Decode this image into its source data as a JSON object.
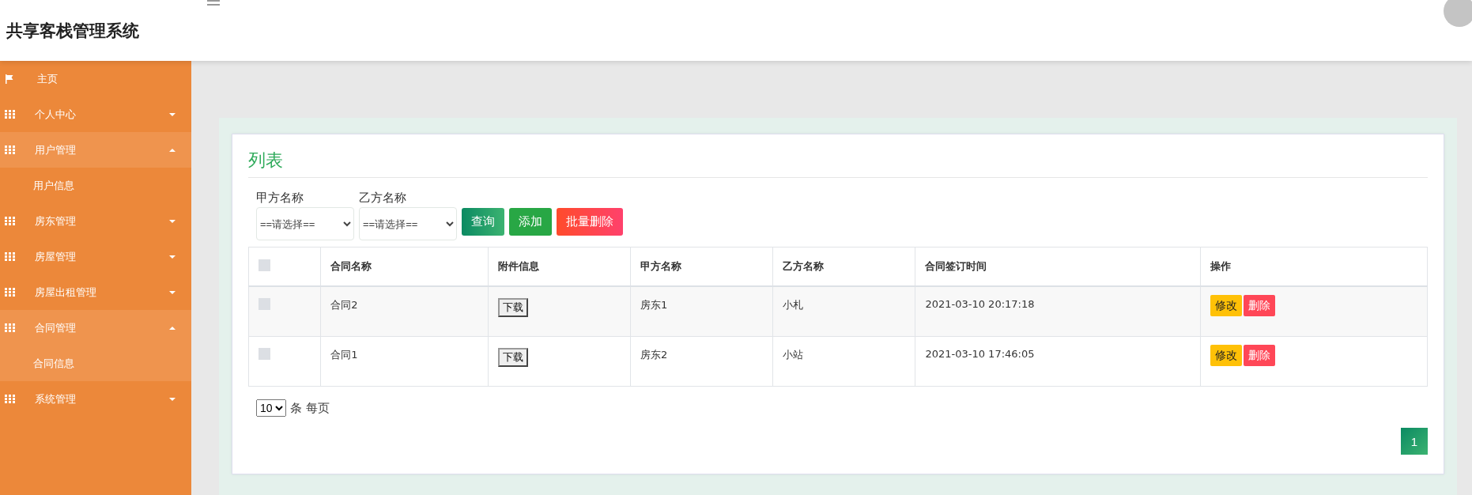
{
  "header": {
    "title": "共享客栈管理系统"
  },
  "sidebar": {
    "items": [
      {
        "label": "主页",
        "kind": "home"
      },
      {
        "label": "个人中心",
        "kind": "group",
        "expanded": false
      },
      {
        "label": "用户管理",
        "kind": "group",
        "expanded": true,
        "children": [
          {
            "label": "用户信息",
            "selected": false
          }
        ]
      },
      {
        "label": "房东管理",
        "kind": "group",
        "expanded": false
      },
      {
        "label": "房屋管理",
        "kind": "group",
        "expanded": false
      },
      {
        "label": "房屋出租管理",
        "kind": "group",
        "expanded": false
      },
      {
        "label": "合同管理",
        "kind": "group",
        "expanded": true,
        "children": [
          {
            "label": "合同信息",
            "selected": true
          }
        ]
      },
      {
        "label": "系统管理",
        "kind": "group",
        "expanded": false
      }
    ]
  },
  "panel": {
    "title": "列表",
    "filters": [
      {
        "label": "甲方名称",
        "value": "==请选择=="
      },
      {
        "label": "乙方名称",
        "value": "==请选择=="
      }
    ],
    "buttons": [
      {
        "label": "查询",
        "kind": "search"
      },
      {
        "label": "添加",
        "kind": "add"
      },
      {
        "label": "批量删除",
        "kind": "delete"
      }
    ],
    "table": {
      "select_all_checked": false,
      "columns": [
        "合同名称",
        "附件信息",
        "甲方名称",
        "乙方名称",
        "合同签订时间",
        "操作"
      ],
      "rows": [
        {
          "checked": false,
          "name": "合同2",
          "attachment": "下载",
          "party_a": "房东1",
          "party_b": "小札",
          "signed": "2021-03-10 20:17:18",
          "actions": [
            "修改",
            "删除"
          ]
        },
        {
          "checked": false,
          "name": "合同1",
          "attachment": "下载",
          "party_a": "房东2",
          "party_b": "小站",
          "signed": "2021-03-10 17:46:05",
          "actions": [
            "修改",
            "删除"
          ]
        }
      ]
    },
    "page_size": {
      "value": "10",
      "suffix": "条 每页"
    },
    "pages": [
      {
        "label": "1",
        "selected": true
      }
    ]
  }
}
